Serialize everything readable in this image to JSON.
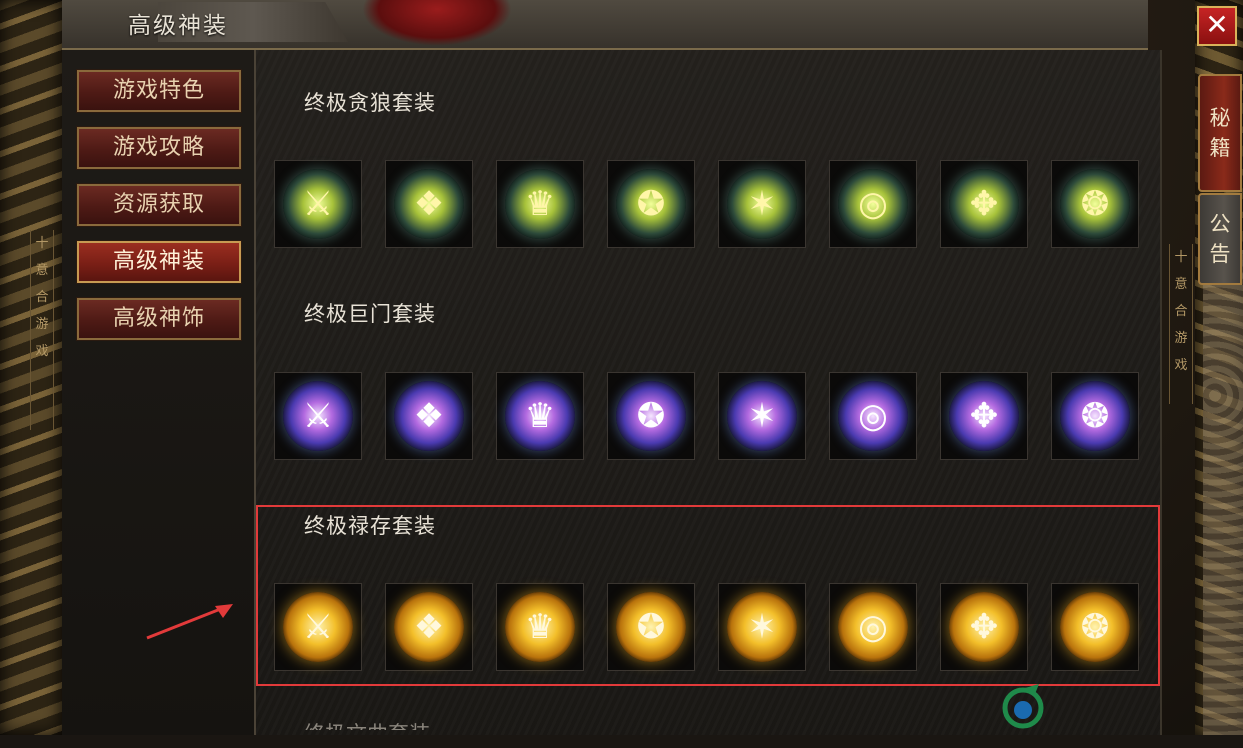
{
  "window": {
    "title": "高级神装",
    "close_label": "✕"
  },
  "side_tabs": [
    {
      "chars": [
        "秘",
        "籍"
      ]
    },
    {
      "chars": [
        "公",
        "告"
      ]
    }
  ],
  "pillar_left_text": [
    "十",
    "意",
    "合",
    "游",
    "戏"
  ],
  "pillar_right_text": [
    "十",
    "意",
    "合",
    "游",
    "戏"
  ],
  "menu": {
    "items": [
      {
        "label": "游戏特色",
        "active": false
      },
      {
        "label": "游戏攻略",
        "active": false
      },
      {
        "label": "资源获取",
        "active": false
      },
      {
        "label": "高级神装",
        "active": true
      },
      {
        "label": "高级神饰",
        "active": false
      }
    ]
  },
  "sections": [
    {
      "title": "终极贪狼套装",
      "theme": "green",
      "items": [
        "weapon-icon",
        "armor-icon",
        "helmet-icon",
        "necklace-icon",
        "bracelet-icon",
        "ring-icon",
        "belt-icon",
        "boots-icon"
      ]
    },
    {
      "title": "终极巨门套装",
      "theme": "purple",
      "items": [
        "weapon-icon",
        "armor-icon",
        "helmet-icon",
        "necklace-icon",
        "bracelet-icon",
        "ring-icon",
        "belt-icon",
        "boots-icon"
      ]
    },
    {
      "title": "终极禄存套装",
      "theme": "gold",
      "items": [
        "weapon-icon",
        "armor-icon",
        "helmet-icon",
        "necklace-icon",
        "bracelet-icon",
        "ring-icon",
        "belt-icon",
        "boots-icon"
      ]
    }
  ],
  "fourth_section_partial": "终极文曲套装",
  "colors": {
    "highlight": "#e23a3a",
    "green_glow": "#a7c23a",
    "purple_glow": "#b36ae0",
    "gold_glow": "#f3bf2a"
  }
}
